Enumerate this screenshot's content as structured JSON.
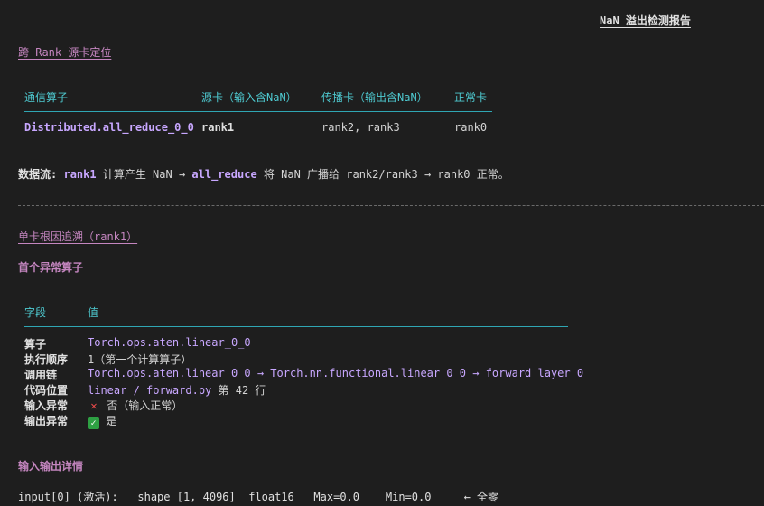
{
  "report_title": "NaN 溢出检测报告",
  "section1": {
    "heading": "跨 Rank 源卡定位",
    "table": {
      "headers": [
        "通信算子",
        "源卡（输入含NaN）",
        "传播卡（输出含NaN）",
        "正常卡"
      ],
      "row": [
        "Distributed.all_reduce_0_0",
        "rank1",
        "rank2, rank3",
        "rank0"
      ]
    },
    "dataflow": {
      "prefix": "数据流:",
      "rank": "rank1",
      "mid1": "计算产生 NaN →",
      "op": "all_reduce",
      "mid2": "将 NaN 广播给 rank2/rank3 → rank0 正常。"
    }
  },
  "section2": {
    "heading": "单卡根因追溯（rank1）",
    "subheading": "首个异常算子",
    "table": {
      "headers": [
        "字段",
        "值"
      ],
      "rows": [
        {
          "field": "算子",
          "value": "Torch.ops.aten.linear_0_0"
        },
        {
          "field": "执行顺序",
          "value": "1（第一个计算算子）"
        },
        {
          "field": "调用链",
          "value": "Torch.ops.aten.linear_0_0 → Torch.nn.functional.linear_0_0 → forward_layer_0"
        },
        {
          "field": "代码位置",
          "value_a": "linear / forward.py",
          "value_b": "第 42 行"
        },
        {
          "field": "输入异常",
          "icon": "cross-icon",
          "value": "否（输入正常）"
        },
        {
          "field": "输出异常",
          "icon": "check-icon",
          "value": "是"
        }
      ]
    },
    "io_heading": "输入输出详情",
    "io_line": "input[0] (激活):   shape [1, 4096]  float16   Max=0.0    Min=0.0     ← 全零"
  },
  "colors": {
    "accent_link": "#c586c0",
    "table_rule": "#2fa6b3",
    "background": "#1e1e1e"
  }
}
